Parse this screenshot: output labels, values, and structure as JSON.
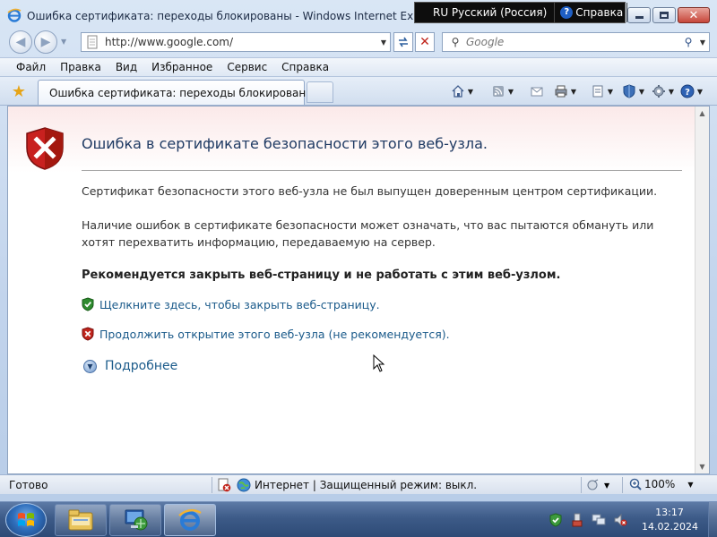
{
  "window": {
    "title": "Ошибка сертификата: переходы блокированы - Windows Internet Explorer",
    "icon": "ie-icon"
  },
  "language_bar": {
    "language": "RU Русский (Россия)",
    "help_label": "Справка"
  },
  "address_bar": {
    "url": "http://www.google.com/"
  },
  "search": {
    "placeholder": "Google"
  },
  "menu": {
    "items": [
      "Файл",
      "Правка",
      "Вид",
      "Избранное",
      "Сервис",
      "Справка"
    ]
  },
  "tab": {
    "label": "Ошибка сертификата: переходы блокированы"
  },
  "command_bar": {
    "icons": [
      "home-icon",
      "feeds-icon",
      "read-mail-icon",
      "print-icon",
      "page-icon",
      "safety-icon",
      "tools-icon",
      "help-icon"
    ]
  },
  "page": {
    "title": "Ошибка в сертификате безопасности этого веб-узла.",
    "paragraph1": "Сертификат безопасности этого веб-узла не был выпущен доверенным центром сертификации.",
    "paragraph2": "Наличие ошибок в сертификате безопасности может означать, что вас пытаются обмануть или хотят перехватить информацию, передаваемую на сервер.",
    "recommendation": "Рекомендуется закрыть веб-страницу и не работать с этим веб-узлом.",
    "close_link": "Щелкните здесь, чтобы закрыть веб-страницу.",
    "continue_link": "Продолжить открытие этого веб-узла (не рекомендуется).",
    "more_info": "Подробнее"
  },
  "status": {
    "text": "Готово",
    "zone": "Интернет | Защищенный режим: выкл.",
    "zoom": "100%"
  },
  "taskbar": {
    "apps": [
      "explorer-icon",
      "network-icon",
      "ie-icon"
    ],
    "clock_time": "13:17",
    "clock_date": "14.02.2024"
  },
  "colors": {
    "link": "#1a5a8a",
    "title": "#1f3a63",
    "error_red": "#c0241b",
    "safe_green": "#2e8b2e"
  }
}
